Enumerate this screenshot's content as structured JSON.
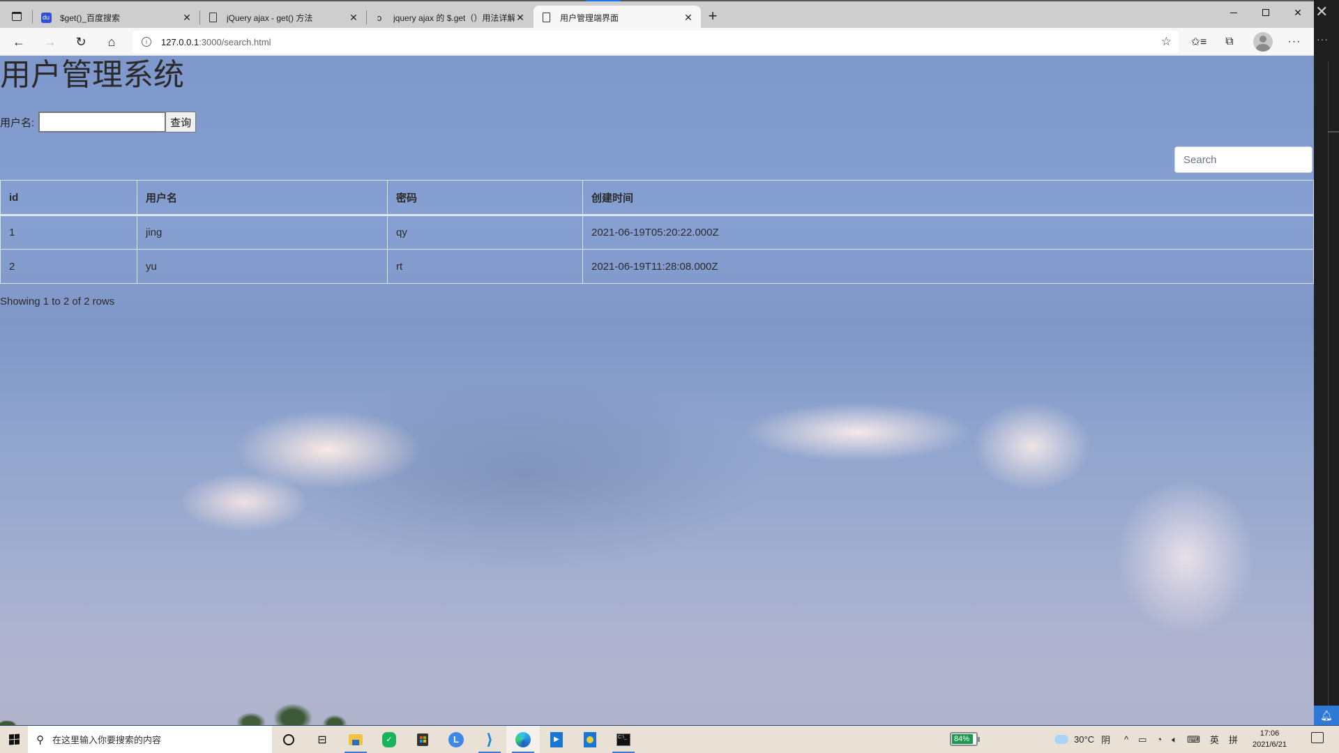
{
  "browser": {
    "tabs": [
      {
        "title": "$get()_百度搜索",
        "icon": "baidu-icon",
        "active": false
      },
      {
        "title": "jQuery ajax - get() 方法",
        "icon": "document-icon",
        "active": false
      },
      {
        "title": "jquery ajax 的 $.get（）用法详解",
        "icon": "site-icon",
        "active": false
      },
      {
        "title": "用户管理端界面",
        "icon": "document-icon",
        "active": true
      }
    ],
    "new_tab_label": "+",
    "close_glyph": "✕",
    "url_host": "127.0.0.1",
    "url_rest": ":3000/search.html",
    "window_controls": {
      "close": "✕"
    },
    "toolbar_more": "···"
  },
  "page": {
    "title": "用户管理系统",
    "query": {
      "label": "用户名:",
      "input_value": "",
      "button_label": "查询"
    },
    "table_search_placeholder": "Search",
    "table": {
      "columns": [
        "id",
        "用户名",
        "密码",
        "创建时间"
      ],
      "rows": [
        [
          "1",
          "jing",
          "qy",
          "2021-06-19T05:20:22.000Z"
        ],
        [
          "2",
          "yu",
          "rt",
          "2021-06-19T11:28:08.000Z"
        ]
      ]
    },
    "pagination_info": "Showing 1 to 2 of 2 rows"
  },
  "taskbar": {
    "search_placeholder": "在这里输入你要搜索的内容",
    "apps": [
      "cortana",
      "task-view",
      "file-explorer",
      "wechat",
      "microsoft-store",
      "l-app",
      "vscode",
      "edge",
      "blue-app",
      "yellow-app",
      "terminal"
    ],
    "battery_percent": "84%",
    "battery_level": 0.84,
    "weather_temp": "30°C",
    "weather_condition": "阴",
    "ime_lang": "英",
    "ime_mode": "拼",
    "time": "17:06",
    "date": "2021/6/21"
  }
}
